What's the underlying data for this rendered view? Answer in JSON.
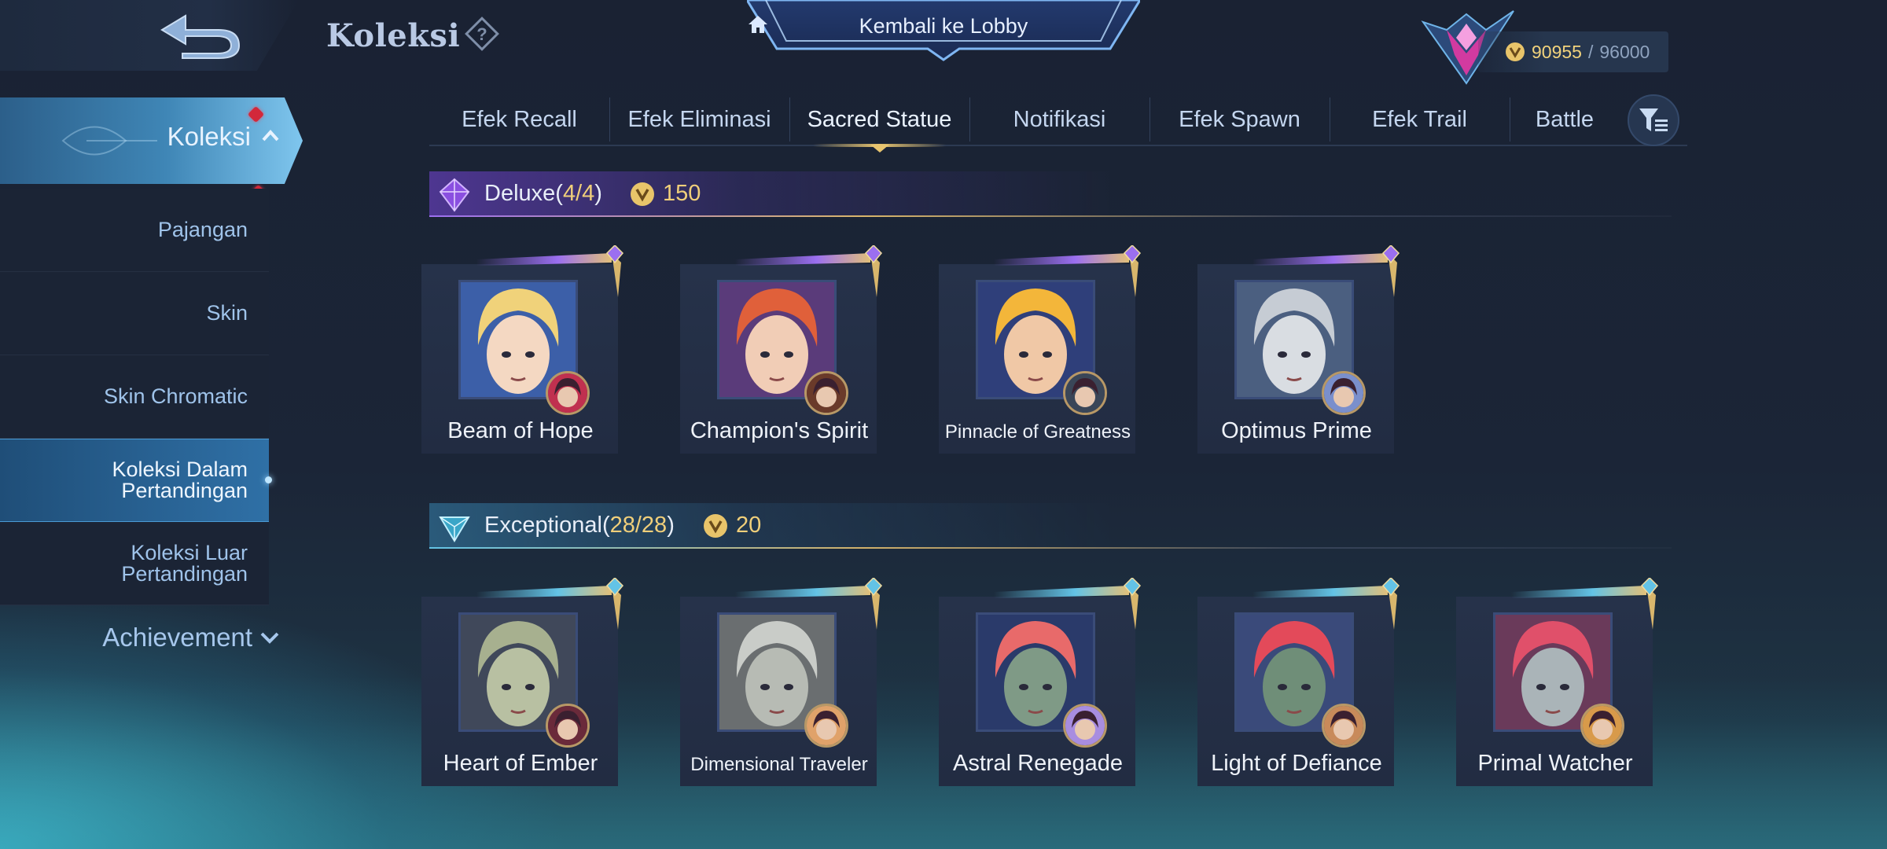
{
  "header": {
    "title": "Koleksi",
    "lobby_label": "Kembali ke Lobby"
  },
  "currency": {
    "current": "90955",
    "separator": "/",
    "max": "96000",
    "color": "#f2d37c"
  },
  "sidebar": {
    "main_label": "Koleksi",
    "items": [
      {
        "label": "Pajangan",
        "active": false
      },
      {
        "label": "Skin",
        "active": false
      },
      {
        "label": "Skin Chromatic",
        "active": false
      },
      {
        "label": "Koleksi Dalam Pertandingan",
        "active": true
      },
      {
        "label": "Koleksi Luar Pertandingan",
        "active": false
      }
    ],
    "achievement_label": "Achievement"
  },
  "tabs": [
    {
      "label": "Efek Recall",
      "active": false
    },
    {
      "label": "Efek Eliminasi",
      "active": false
    },
    {
      "label": "Sacred Statue",
      "active": true
    },
    {
      "label": "Notifikasi",
      "active": false
    },
    {
      "label": "Efek Spawn",
      "active": false
    },
    {
      "label": "Efek Trail",
      "active": false
    },
    {
      "label": "Battle",
      "active": false
    }
  ],
  "sections": [
    {
      "name": "Deluxe",
      "count_open": "(",
      "count": "4/4",
      "count_close": ")",
      "price": "150",
      "accent": "#9b6ff0",
      "cards": [
        {
          "name": "Beam of Hope",
          "hair": "#f0d27a",
          "skin": "#f4d8c2",
          "bg": "#3c5fa8",
          "badge": "#c0304f"
        },
        {
          "name": "Champion's Spirit",
          "hair": "#e0603a",
          "skin": "#f1cdb6",
          "bg": "#5a3b7a",
          "badge": "#6a3a2a"
        },
        {
          "name": "Pinnacle of Greatness",
          "hair": "#f3b63a",
          "skin": "#f0c8a6",
          "bg": "#2f3f7a",
          "badge": "#3a4658"
        },
        {
          "name": "Optimus Prime",
          "hair": "#c6ccd4",
          "skin": "#d9dde2",
          "bg": "#4b5f80",
          "badge": "#7a8fcc"
        }
      ]
    },
    {
      "name": "Exceptional",
      "count_open": "(",
      "count": "28/28",
      "count_close": ")",
      "price": "20",
      "accent": "#63c3e6",
      "cards": [
        {
          "name": "Heart of Ember",
          "hair": "#a7b08f",
          "skin": "#b8c0a2",
          "bg": "#40485a",
          "badge": "#6a2a3a"
        },
        {
          "name": "Dimensional Traveler",
          "hair": "#c9ccc8",
          "skin": "#b7bbb4",
          "bg": "#6a6e70",
          "badge": "#e0a26a"
        },
        {
          "name": "Astral Renegade",
          "hair": "#e86a6a",
          "skin": "#7f9a86",
          "bg": "#2a3a6a",
          "badge": "#a88de0"
        },
        {
          "name": "Light of Defiance",
          "hair": "#e34a5a",
          "skin": "#6f8e78",
          "bg": "#3a4a7a",
          "badge": "#c88a5a"
        },
        {
          "name": "Primal Watcher",
          "hair": "#e0506a",
          "skin": "#aab4b8",
          "bg": "#6a3a5a",
          "badge": "#d89a4a"
        }
      ]
    }
  ]
}
